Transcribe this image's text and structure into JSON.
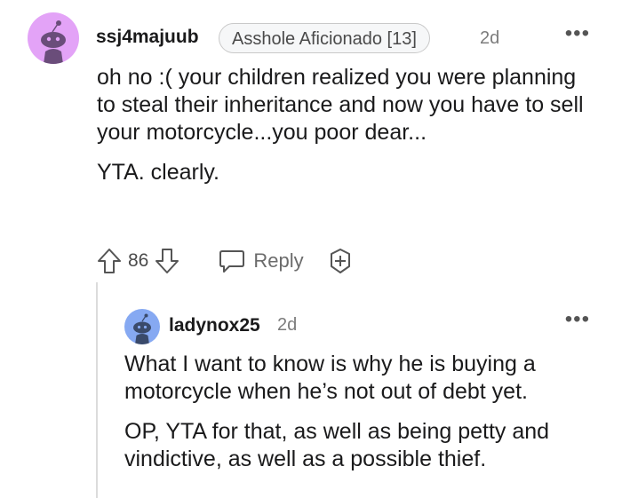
{
  "comment1": {
    "username": "ssj4majuub",
    "flair": "Asshole Aficionado [13]",
    "time": "2d",
    "more": "•••",
    "paragraphs": [
      "oh no :( your children realized you were planning to steal their inheritance and now you have to sell your motorcycle...you poor dear...",
      "YTA. clearly."
    ],
    "votes": "86",
    "reply_label": "Reply",
    "avatar_color": "#e3a3f7",
    "icons": [
      "upvote-icon",
      "downvote-icon",
      "reply-icon",
      "award-icon",
      "more-options-icon"
    ]
  },
  "comment2": {
    "username": "ladynox25",
    "time": "2d",
    "more": "•••",
    "paragraphs": [
      "What I want to know is why he is buying a motorcycle when he’s not out of debt yet.",
      "OP, YTA for that, as well as being petty and vindictive, as well as a possible thief."
    ],
    "avatar_color": "#86a9f2"
  }
}
